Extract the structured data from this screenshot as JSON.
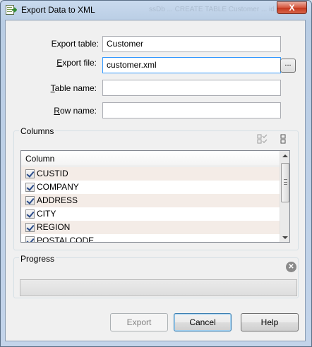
{
  "window": {
    "title": "Export Data to XML",
    "title_ghost": "ssDb ... CREATE TABLE Customer ... id ID",
    "close_glyph": "X"
  },
  "form": {
    "export_table_label": "Export table:",
    "export_table_value": "Customer",
    "export_file_label": "Export file:",
    "export_file_value": "customer.xml",
    "browse_label": "...",
    "table_name_label": "Table name:",
    "table_name_value": "",
    "row_name_label": "Row name:",
    "row_name_value": ""
  },
  "columns": {
    "group_title": "Columns",
    "header": "Column",
    "rows": [
      {
        "name": "CUSTID",
        "checked": true
      },
      {
        "name": "COMPANY",
        "checked": true
      },
      {
        "name": "ADDRESS",
        "checked": true
      },
      {
        "name": "CITY",
        "checked": true
      },
      {
        "name": "REGION",
        "checked": true
      },
      {
        "name": "POSTALCODE",
        "checked": true
      }
    ]
  },
  "progress": {
    "group_title": "Progress",
    "value": 0
  },
  "buttons": {
    "export": "Export",
    "cancel": "Cancel",
    "help": "Help"
  },
  "icons": {
    "app": "export-xml-icon",
    "check_all": "check-all-icon",
    "select_toggle": "select-toggle-icon",
    "stop": "stop-icon"
  }
}
